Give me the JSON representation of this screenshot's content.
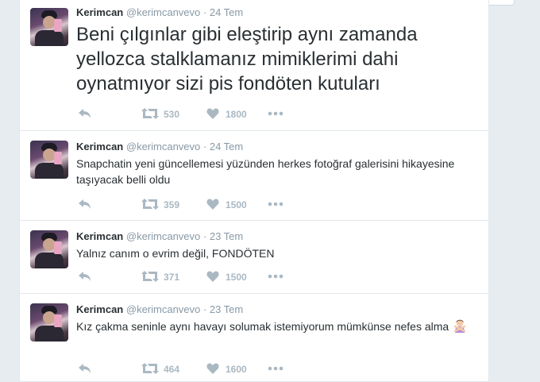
{
  "tweets": [
    {
      "name": "Kerimcan",
      "handle": "@kerimcanvevo",
      "date": "· 24 Tem",
      "text": "Beni çılgınlar gibi eleştirip aynı zamanda yellozca  stalklamanız mimiklerimi dahi oynatmıyor sizi pis fondöten kutuları",
      "retweets": "530",
      "likes": "1800"
    },
    {
      "name": "Kerimcan",
      "handle": "@kerimcanvevo",
      "date": "· 24 Tem",
      "text": "Snapchatin yeni güncellemesi yüzünden herkes fotoğraf galerisini hikayesine taşıyacak belli oldu",
      "retweets": "359",
      "likes": "1500"
    },
    {
      "name": "Kerimcan",
      "handle": "@kerimcanvevo",
      "date": "· 23 Tem",
      "text": "Yalnız canım o evrim değil, FONDÖTEN",
      "retweets": "371",
      "likes": "1500"
    },
    {
      "name": "Kerimcan",
      "handle": "@kerimcanvevo",
      "date": "· 23 Tem",
      "text": "Kız çakma seninle aynı havayı solumak istemiyorum mümkünse nefes alma",
      "text_emoji": "woman-gesturing-no-emoji",
      "retweets": "464",
      "likes": "1600"
    }
  ],
  "icons": {
    "reply": "reply-icon",
    "retweet": "retweet-icon",
    "like": "heart-icon",
    "more": "more-icon"
  },
  "colors": {
    "name": "#292f33",
    "meta": "#8899a6",
    "action": "#aab8c2",
    "background": "#e6ecf0"
  }
}
